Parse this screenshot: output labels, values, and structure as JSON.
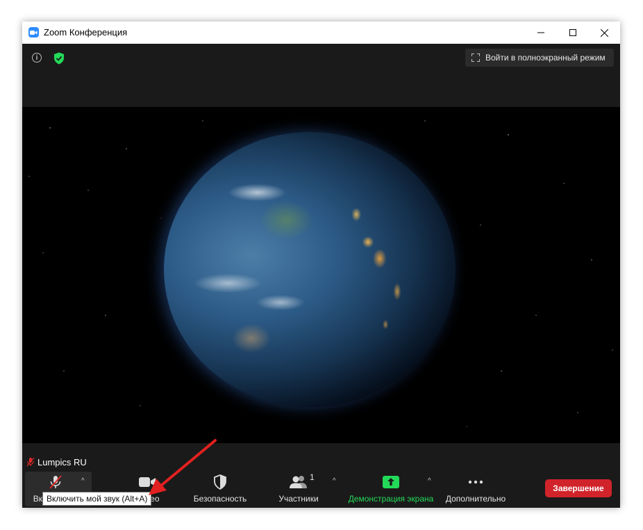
{
  "window": {
    "title": "Zoom Конференция",
    "controls": {
      "minimize": "—",
      "maximize": "☐",
      "close": "✕"
    }
  },
  "topbar": {
    "info_icon": "info-icon",
    "security_icon": "shield-check-icon",
    "fullscreen_label": "Войти в полноэкранный режим"
  },
  "participant": {
    "name": "Lumpics RU",
    "mic_state": "muted"
  },
  "toolbar": {
    "mute_label": "Вкл",
    "video_label": "Видео",
    "security_label": "Безопасность",
    "participants_label": "Участники",
    "participants_count": "1",
    "share_label": "Демонстрация экрана",
    "more_label": "Дополнительно",
    "end_label": "Завершение"
  },
  "tooltip": {
    "text": "Включить мой звук (Alt+A)"
  },
  "colors": {
    "accent_green": "#23d959",
    "end_red": "#d1232a",
    "zoom_blue": "#2d8cff",
    "annotation_red": "#e32020"
  }
}
